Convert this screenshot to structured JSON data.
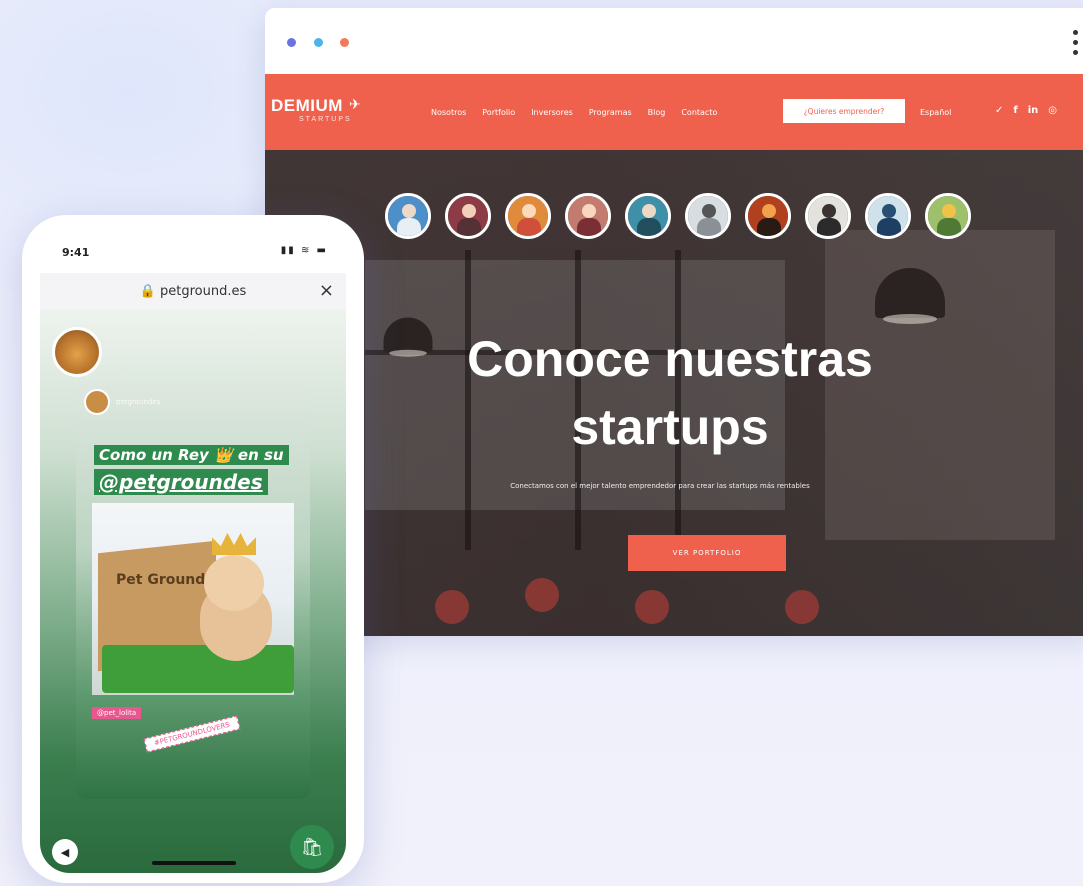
{
  "browser": {
    "site": {
      "logo_name": "DEMIUM",
      "logo_sub": "STARTUPS",
      "menu": [
        "Nosotros",
        "Portfolio",
        "Inversores",
        "Programas",
        "Blog",
        "Contacto"
      ],
      "cta": "¿Quieres emprender?",
      "language": "Español",
      "socials": [
        "twitter",
        "facebook",
        "linkedin",
        "instagram"
      ]
    },
    "hero": {
      "title_line1": "Conoce nuestras",
      "title_line2": "startups",
      "subtitle": "Conectamos con el mejor talento emprendedor para crear las startups más rentables",
      "button": "VER PORTFOLIO",
      "avatar_count": 10
    }
  },
  "phone": {
    "time": "9:41",
    "status_icons": "▮▮ ≋ ▬",
    "url": "🔒 petground.es",
    "close": "×",
    "story": {
      "handle": "petgroundes",
      "tag_line1": "Como un Rey 👑 en su",
      "tag_line2": "@petgroundes",
      "box_label": "Pet Ground",
      "pill1": "@pet_lolita",
      "pill2": "#PETGROUNDLOVERS"
    }
  },
  "colors": {
    "brand": "#f0614d",
    "story_green": "#2f8a4d"
  }
}
